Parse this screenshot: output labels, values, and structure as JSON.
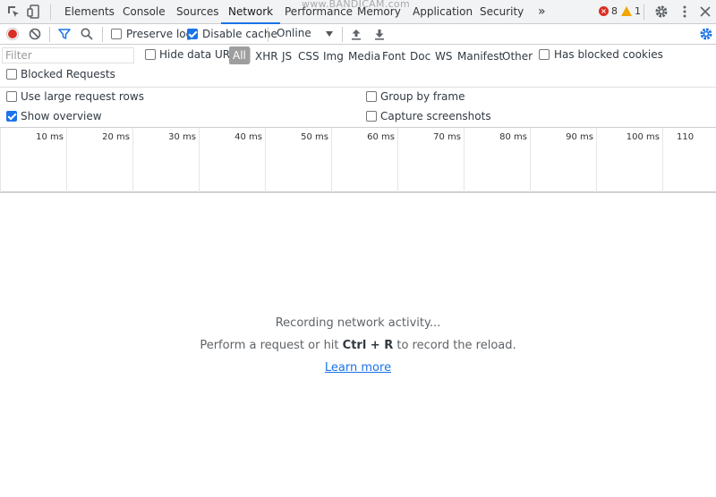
{
  "devtools": {
    "tabs": [
      {
        "label": "Elements"
      },
      {
        "label": "Console"
      },
      {
        "label": "Sources"
      },
      {
        "label": "Network"
      },
      {
        "label": "Performance"
      },
      {
        "label": "Memory"
      },
      {
        "label": "Application"
      },
      {
        "label": "Security"
      }
    ],
    "more_tabs_label": "»",
    "watermark": "www.BANDICAM.com",
    "error_count": "8",
    "warning_count": "1",
    "selected_tab": "Network"
  },
  "toolbar": {
    "preserve_log_label": "Preserve log",
    "preserve_log_checked": false,
    "disable_cache_label": "Disable cache",
    "disable_cache_checked": true,
    "throttle_value": "Online"
  },
  "filter": {
    "placeholder": "Filter",
    "hide_data_urls_label": "Hide data URLs",
    "types": [
      "All",
      "XHR",
      "JS",
      "CSS",
      "Img",
      "Media",
      "Font",
      "Doc",
      "WS",
      "Manifest",
      "Other"
    ],
    "selected_type": "All",
    "has_blocked_cookies_label": "Has blocked cookies",
    "blocked_requests_label": "Blocked Requests"
  },
  "settings": {
    "use_large_rows_label": "Use large request rows",
    "group_by_frame_label": "Group by frame",
    "show_overview_label": "Show overview",
    "show_overview_checked": true,
    "capture_screenshots_label": "Capture screenshots"
  },
  "overview": {
    "ticks": [
      "10 ms",
      "20 ms",
      "30 ms",
      "40 ms",
      "50 ms",
      "60 ms",
      "70 ms",
      "80 ms",
      "90 ms",
      "100 ms",
      "110"
    ]
  },
  "empty_state": {
    "line1": "Recording network activity...",
    "line2_prefix": "Perform a request or hit ",
    "line2_key": "Ctrl + R",
    "line2_suffix": " to record the reload.",
    "learn_more": "Learn more"
  },
  "colors": {
    "accent": "#1a73e8",
    "record_red": "#d93025",
    "warning": "#f2a600"
  }
}
